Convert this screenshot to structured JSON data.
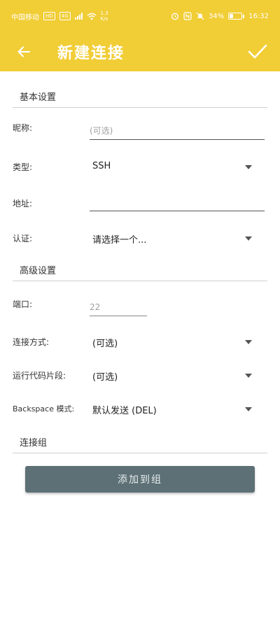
{
  "status_bar": {
    "carrier": "中国移动",
    "hd_badge": "HD",
    "network_badge": "4G",
    "speed": "1.3 K/s",
    "battery_percent": "34%",
    "battery_level": 0.34,
    "time": "16:32"
  },
  "app_bar": {
    "title": "新建连接"
  },
  "basic_section": {
    "title": "基本设置",
    "nickname_label": "昵称:",
    "nickname_placeholder": "(可选)",
    "nickname_value": "",
    "type_label": "类型:",
    "type_value": "SSH",
    "address_label": "地址:",
    "address_value": "",
    "auth_label": "认证:",
    "auth_value": "请选择一个..."
  },
  "advanced_section": {
    "title": "高级设置",
    "port_label": "端口:",
    "port_placeholder": "22",
    "connect_mode_label": "连接方式:",
    "connect_mode_value": "(可选)",
    "snippet_label": "运行代码片段:",
    "snippet_value": "(可选)",
    "backspace_label": "Backspace 模式:",
    "backspace_value": "默认发送 (DEL)"
  },
  "group_section": {
    "title": "连接组",
    "add_button_label": "添加到组"
  },
  "colors": {
    "accent": "#f1cd36",
    "button": "#5d7076"
  }
}
